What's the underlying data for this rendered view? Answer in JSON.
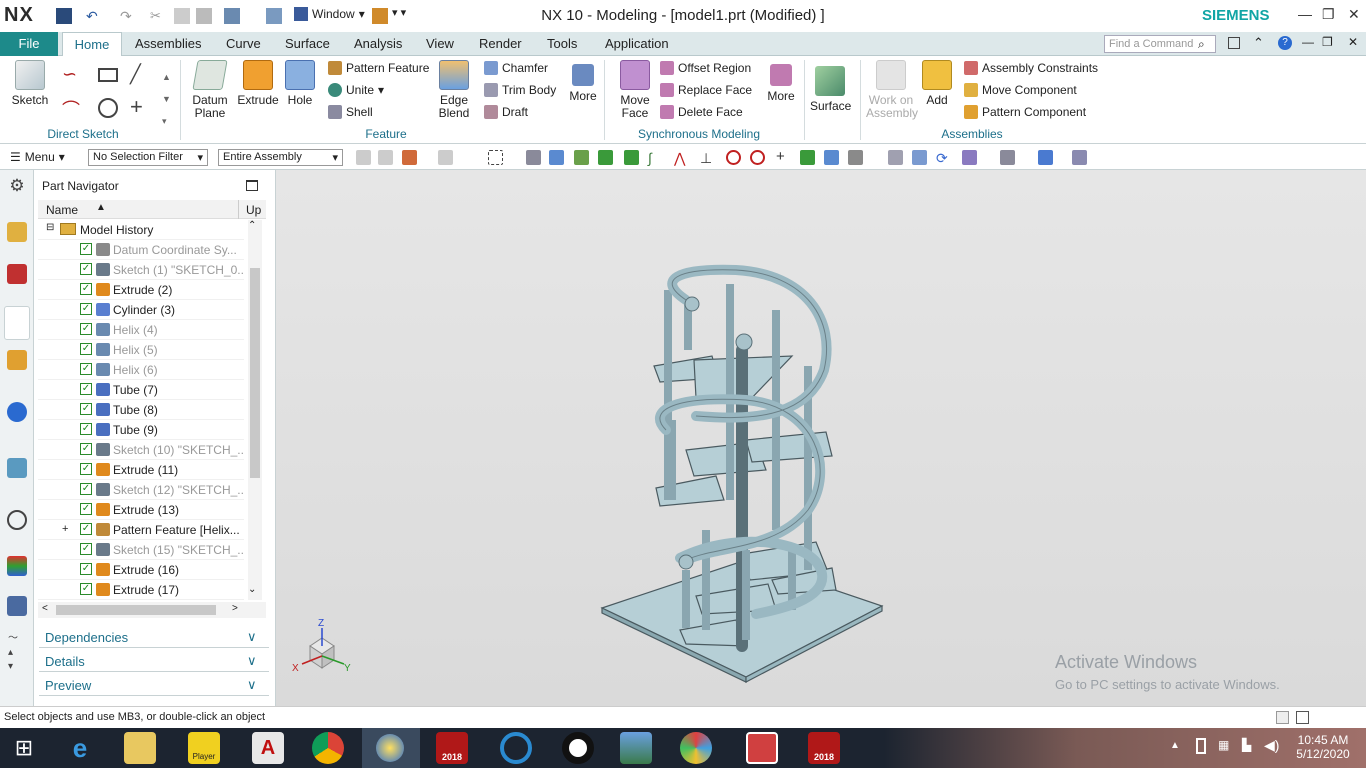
{
  "titlebar": {
    "logo": "NX",
    "title": "NX 10 - Modeling - [model1.prt (Modified) ]",
    "window_menu": "Window",
    "brand": "SIEMENS",
    "minimize": "—",
    "restore": "❐",
    "close": "✕"
  },
  "tabs": {
    "file": "File",
    "items": [
      "Home",
      "Assemblies",
      "Curve",
      "Surface",
      "Analysis",
      "View",
      "Render",
      "Tools",
      "Application"
    ],
    "find_placeholder": "Find a Command"
  },
  "ribbon": {
    "direct_sketch": {
      "sketch": "Sketch",
      "group": "Direct Sketch"
    },
    "feature": {
      "datum_plane": "Datum\nPlane",
      "extrude": "Extrude",
      "hole": "Hole",
      "pattern_feature": "Pattern Feature",
      "unite": "Unite",
      "shell": "Shell",
      "edge_blend": "Edge\nBlend",
      "chamfer": "Chamfer",
      "trim_body": "Trim Body",
      "draft": "Draft",
      "more": "More",
      "group": "Feature"
    },
    "sync": {
      "move_face": "Move\nFace",
      "offset_region": "Offset Region",
      "replace_face": "Replace Face",
      "delete_face": "Delete Face",
      "more": "More",
      "group": "Synchronous Modeling"
    },
    "surface": {
      "label": "Surface"
    },
    "assemblies": {
      "work_on_assembly": "Work on\nAssembly",
      "add": "Add",
      "assembly_constraints": "Assembly Constraints",
      "move_component": "Move Component",
      "pattern_component": "Pattern Component",
      "group": "Assemblies"
    }
  },
  "toolbar2": {
    "menu": "Menu",
    "selection_filter": "No Selection Filter",
    "scope": "Entire Assembly"
  },
  "navigator": {
    "title": "Part Navigator",
    "col_name": "Name",
    "col_up": "Up",
    "root": "Model History",
    "rows": [
      {
        "label": "Datum Coordinate Sy...",
        "dim": true,
        "icon": "datum-csys-icon",
        "color": "#8a8a8a"
      },
      {
        "label": "Sketch (1) \"SKETCH_0...",
        "dim": true,
        "icon": "sketch-icon",
        "color": "#6a7a8a"
      },
      {
        "label": "Extrude (2)",
        "dim": false,
        "icon": "extrude-icon",
        "color": "#e08a1e"
      },
      {
        "label": "Cylinder (3)",
        "dim": false,
        "icon": "cylinder-icon",
        "color": "#5a7fd0"
      },
      {
        "label": "Helix (4)",
        "dim": true,
        "icon": "helix-icon",
        "color": "#6a8ab0"
      },
      {
        "label": "Helix (5)",
        "dim": true,
        "icon": "helix-icon",
        "color": "#6a8ab0"
      },
      {
        "label": "Helix (6)",
        "dim": true,
        "icon": "helix-icon",
        "color": "#6a8ab0"
      },
      {
        "label": "Tube (7)",
        "dim": false,
        "icon": "tube-icon",
        "color": "#4a6fc0"
      },
      {
        "label": "Tube (8)",
        "dim": false,
        "icon": "tube-icon",
        "color": "#4a6fc0"
      },
      {
        "label": "Tube (9)",
        "dim": false,
        "icon": "tube-icon",
        "color": "#4a6fc0"
      },
      {
        "label": "Sketch (10) \"SKETCH_...",
        "dim": true,
        "icon": "sketch-icon",
        "color": "#6a7a8a"
      },
      {
        "label": "Extrude (11)",
        "dim": false,
        "icon": "extrude-icon",
        "color": "#e08a1e"
      },
      {
        "label": "Sketch (12) \"SKETCH_...",
        "dim": true,
        "icon": "sketch-icon",
        "color": "#6a7a8a"
      },
      {
        "label": "Extrude (13)",
        "dim": false,
        "icon": "extrude-icon",
        "color": "#e08a1e"
      },
      {
        "label": "Pattern Feature [Helix...",
        "dim": false,
        "icon": "pattern-feature-icon",
        "color": "#c08a3a",
        "expandable": true
      },
      {
        "label": "Sketch (15) \"SKETCH_...",
        "dim": true,
        "icon": "sketch-icon",
        "color": "#6a7a8a"
      },
      {
        "label": "Extrude (16)",
        "dim": false,
        "icon": "extrude-icon",
        "color": "#e08a1e"
      },
      {
        "label": "Extrude (17)",
        "dim": false,
        "icon": "extrude-icon",
        "color": "#e08a1e"
      }
    ],
    "panels": [
      "Dependencies",
      "Details",
      "Preview"
    ]
  },
  "viewport": {
    "triad": {
      "z": "Z",
      "x": "X",
      "y": "Y"
    },
    "watermark_title": "Activate Windows",
    "watermark_sub": "Go to PC settings to activate Windows."
  },
  "status": {
    "prompt": "Select objects and use MB3, or double-click an object"
  },
  "taskbar": {
    "time": "10:45 AM",
    "date": "5/12/2020",
    "apps": [
      "start-icon",
      "internet-explorer-icon",
      "file-explorer-icon",
      "player-icon",
      "acrobat-icon",
      "chrome-icon",
      "nx-icon",
      "solidworks-2018-icon",
      "camera-icon",
      "record-icon",
      "photos-icon",
      "paint-icon",
      "presentation-icon",
      "solidworks-2018-icon"
    ],
    "player_label": "Player",
    "sw_label": "2018"
  },
  "colors": {
    "accent": "#1d8a8a",
    "brand": "#11a5a5",
    "staircase": "#b6cfd6"
  }
}
